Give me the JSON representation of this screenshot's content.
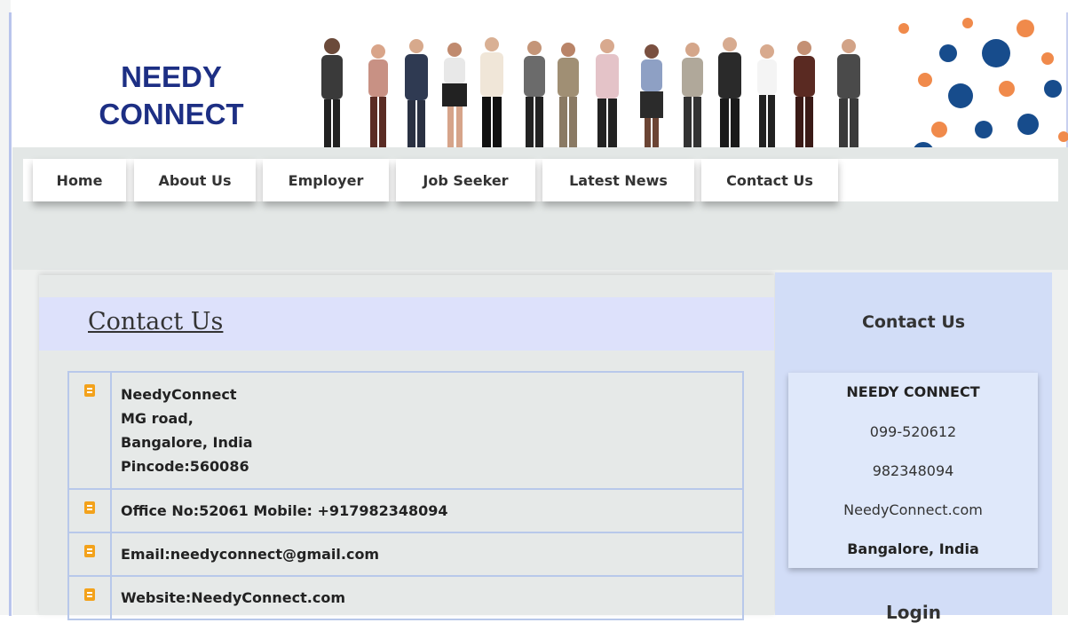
{
  "header": {
    "logo_line1": "NEEDY",
    "logo_line2": "CONNECT"
  },
  "nav": {
    "items": [
      {
        "label": "Home"
      },
      {
        "label": "About Us"
      },
      {
        "label": "Employer"
      },
      {
        "label": "Job Seeker"
      },
      {
        "label": "Latest News"
      },
      {
        "label": "Contact Us"
      }
    ]
  },
  "main": {
    "title": "Contact Us",
    "address": {
      "name": "NeedyConnect",
      "line1": "MG road,",
      "line2": "Bangalore, India",
      "pincode": "Pincode:560086"
    },
    "phone": "Office No:52061 Mobile: +917982348094",
    "email": "Email:needyconnect@gmail.com",
    "website": "Website:NeedyConnect.com"
  },
  "sidebar": {
    "title": "Contact Us",
    "card": {
      "name": "NEEDY CONNECT",
      "phone1": "099-520612",
      "phone2": "982348094",
      "site": "NeedyConnect.com",
      "city": "Bangalore, India"
    },
    "next_section": "Login"
  },
  "colors": {
    "logo": "#1d2f84",
    "bullet": "#f3a21b",
    "sidebar_bg": "#d2ddf7",
    "content_head_bg": "#dde1fb"
  }
}
